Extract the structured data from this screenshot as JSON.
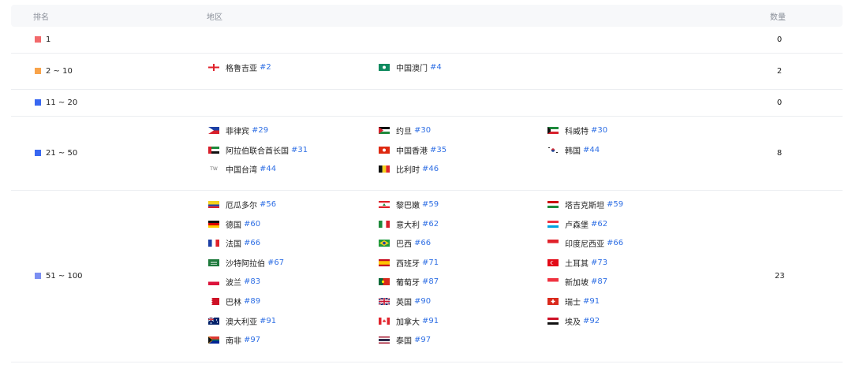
{
  "header": {
    "rank": "排名",
    "region": "地区",
    "count": "数量"
  },
  "tiers": [
    {
      "rank": "1",
      "color": "#f2696b",
      "count": "0",
      "items": []
    },
    {
      "rank": "2 ~ 10",
      "color": "#f8a34a",
      "count": "2",
      "items": [
        {
          "name": "格鲁吉亚",
          "rank": "#2",
          "flag": "georgia-flag"
        },
        {
          "name": "中国澳门",
          "rank": "#4",
          "flag": "macau-flag"
        }
      ]
    },
    {
      "rank": "11 ~ 20",
      "color": "#3867f1",
      "count": "0",
      "items": []
    },
    {
      "rank": "21 ~ 50",
      "color": "#3867f1",
      "count": "8",
      "items": [
        {
          "name": "菲律宾",
          "rank": "#29",
          "flag": "philippines-flag"
        },
        {
          "name": "约旦",
          "rank": "#30",
          "flag": "jordan-flag"
        },
        {
          "name": "科威特",
          "rank": "#30",
          "flag": "kuwait-flag"
        },
        {
          "name": "阿拉伯联合酋长国",
          "rank": "#31",
          "flag": "uae-flag"
        },
        {
          "name": "中国香港",
          "rank": "#35",
          "flag": "hongkong-flag"
        },
        {
          "name": "韩国",
          "rank": "#44",
          "flag": "korea-flag"
        },
        {
          "name": "中国台湾",
          "rank": "#44",
          "flag": "taiwan-flag",
          "badge": "TW"
        },
        {
          "name": "比利时",
          "rank": "#46",
          "flag": "belgium-flag"
        }
      ]
    },
    {
      "rank": "51 ~ 100",
      "color": "#7b8ff2",
      "count": "23",
      "items": [
        {
          "name": "厄瓜多尔",
          "rank": "#56",
          "flag": "ecuador-flag"
        },
        {
          "name": "黎巴嫩",
          "rank": "#59",
          "flag": "lebanon-flag"
        },
        {
          "name": "塔吉克斯坦",
          "rank": "#59",
          "flag": "tajikistan-flag"
        },
        {
          "name": "德国",
          "rank": "#60",
          "flag": "germany-flag"
        },
        {
          "name": "意大利",
          "rank": "#62",
          "flag": "italy-flag"
        },
        {
          "name": "卢森堡",
          "rank": "#62",
          "flag": "luxembourg-flag"
        },
        {
          "name": "法国",
          "rank": "#66",
          "flag": "france-flag"
        },
        {
          "name": "巴西",
          "rank": "#66",
          "flag": "brazil-flag"
        },
        {
          "name": "印度尼西亚",
          "rank": "#66",
          "flag": "indonesia-flag"
        },
        {
          "name": "沙特阿拉伯",
          "rank": "#67",
          "flag": "saudi-flag"
        },
        {
          "name": "西班牙",
          "rank": "#71",
          "flag": "spain-flag"
        },
        {
          "name": "土耳其",
          "rank": "#73",
          "flag": "turkey-flag"
        },
        {
          "name": "波兰",
          "rank": "#83",
          "flag": "poland-flag"
        },
        {
          "name": "葡萄牙",
          "rank": "#87",
          "flag": "portugal-flag"
        },
        {
          "name": "新加坡",
          "rank": "#87",
          "flag": "singapore-flag"
        },
        {
          "name": "巴林",
          "rank": "#89",
          "flag": "bahrain-flag"
        },
        {
          "name": "英国",
          "rank": "#90",
          "flag": "uk-flag"
        },
        {
          "name": "瑞士",
          "rank": "#91",
          "flag": "switzerland-flag"
        },
        {
          "name": "澳大利亚",
          "rank": "#91",
          "flag": "australia-flag"
        },
        {
          "name": "加拿大",
          "rank": "#91",
          "flag": "canada-flag"
        },
        {
          "name": "埃及",
          "rank": "#92",
          "flag": "egypt-flag"
        },
        {
          "name": "南非",
          "rank": "#97",
          "flag": "southafrica-flag"
        },
        {
          "name": "泰国",
          "rank": "#97",
          "flag": "thailand-flag"
        }
      ]
    }
  ]
}
